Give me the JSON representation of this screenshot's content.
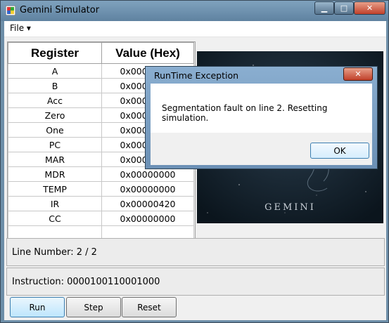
{
  "window": {
    "title": "Gemini Simulator"
  },
  "menu": {
    "file_label": "File ▾"
  },
  "registers": {
    "headers": [
      "Register",
      "Value (Hex)"
    ],
    "rows": [
      {
        "name": "A",
        "value": "0x00000000"
      },
      {
        "name": "B",
        "value": "0x00000000"
      },
      {
        "name": "Acc",
        "value": "0x00000000"
      },
      {
        "name": "Zero",
        "value": "0x00000000"
      },
      {
        "name": "One",
        "value": "0x00000000"
      },
      {
        "name": "PC",
        "value": "0x00000000"
      },
      {
        "name": "MAR",
        "value": "0x00000000"
      },
      {
        "name": "MDR",
        "value": "0x00000000"
      },
      {
        "name": "TEMP",
        "value": "0x00000000"
      },
      {
        "name": "IR",
        "value": "0x00000420"
      },
      {
        "name": "CC",
        "value": "0x00000000"
      },
      {
        "name": "",
        "value": ""
      }
    ]
  },
  "image": {
    "caption": "GEMINI"
  },
  "status": {
    "line_number": "Line Number: 2 / 2",
    "instruction": "Instruction: 0000100110001000"
  },
  "buttons": {
    "run": "Run",
    "step": "Step",
    "reset": "Reset"
  },
  "dialog": {
    "title": "RunTime Exception",
    "message": "Segmentation fault on line 2. Resetting simulation.",
    "ok": "OK"
  }
}
